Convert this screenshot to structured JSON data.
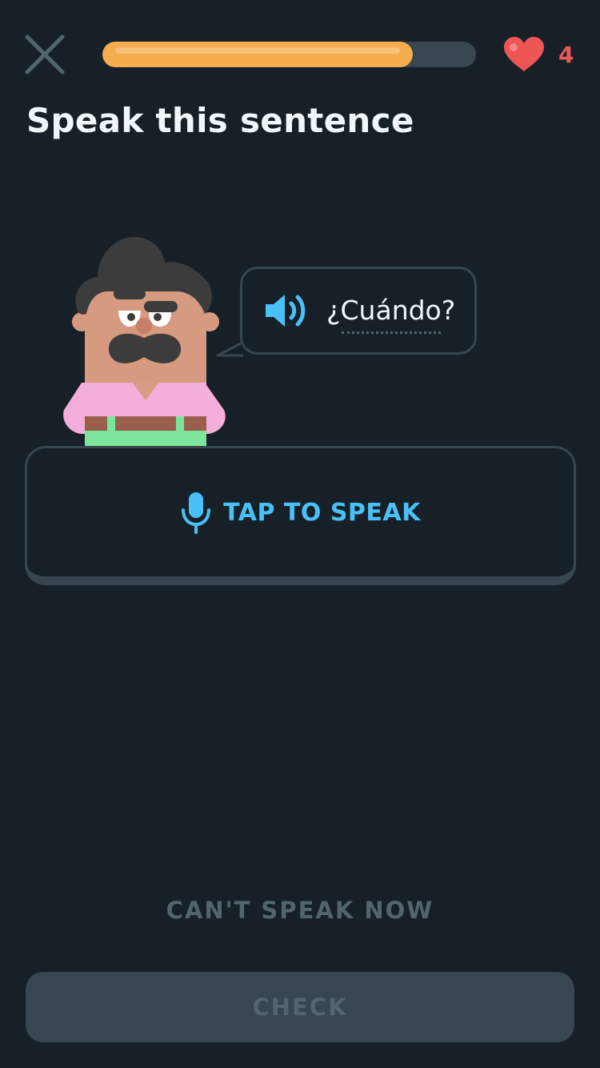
{
  "header": {
    "close_icon": "close-x-icon",
    "progress": 0.83,
    "progress_color": "#f5ad4d",
    "hearts_icon": "heart-icon",
    "hearts_count": "4",
    "hearts_color": "#e85a58"
  },
  "prompt": {
    "title": "Speak this sentence"
  },
  "exercise": {
    "speaker_icon": "speaker-icon",
    "phrase": "¿Cuándo?"
  },
  "speak_button": {
    "icon": "microphone-icon",
    "label": "TAP TO SPEAK",
    "accent_color": "#49c0f8"
  },
  "footer": {
    "cant_speak_label": "CAN'T SPEAK NOW",
    "check_label": "CHECK"
  }
}
